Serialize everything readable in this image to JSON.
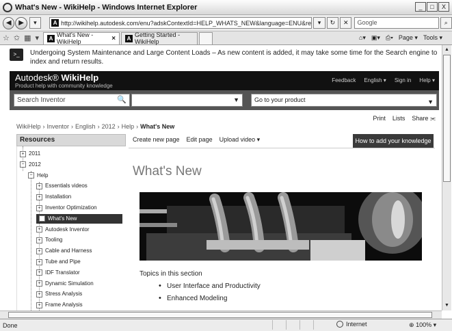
{
  "window": {
    "title": "What's New - WikiHelp - Windows Internet Explorer",
    "buttons": [
      "_",
      "□",
      "X"
    ]
  },
  "address_bar": {
    "url": "http://wikihelp.autodesk.com/enu?adskContextId=HELP_WHATS_NEW&language=ENU&release=2012&product=Inve",
    "search_placeholder": "Google"
  },
  "tabs": [
    {
      "label": "What's New - WikiHelp",
      "active": true
    },
    {
      "label": "Getting Started - WikiHelp",
      "active": false
    }
  ],
  "commandbar": {
    "page_label": "Page",
    "tools_label": "Tools"
  },
  "notice": {
    "text": "Undergoing System Maintenance and Large Content Loads – As new content is added, it may take some time for the Search engine to index and return results."
  },
  "brand": {
    "name_prefix": "Autodesk",
    "name_product": "WikiHelp",
    "tagline": "Product help with community knowledge",
    "links": [
      "Feedback",
      "English ▾",
      "Sign in",
      "Help ▾"
    ]
  },
  "search": {
    "placeholder": "Search Inventor",
    "goto_label": "Go to your product"
  },
  "page_tools": [
    "Print",
    "Lists",
    "Share"
  ],
  "breadcrumb": [
    "WikiHelp",
    "Inventor",
    "English",
    "2012",
    "Help"
  ],
  "breadcrumb_current": "What's New",
  "resources": {
    "title": "Resources",
    "tree": [
      {
        "label": "2011",
        "level": 0,
        "exp": "+"
      },
      {
        "label": "2012",
        "level": 0,
        "exp": "−"
      },
      {
        "label": "Help",
        "level": 1,
        "exp": "−"
      },
      {
        "label": "Essentials videos",
        "level": 2,
        "exp": "+"
      },
      {
        "label": "Installation",
        "level": 2,
        "exp": "+"
      },
      {
        "label": "Inventor Optimization",
        "level": 2,
        "exp": "+"
      },
      {
        "label": "What's New",
        "level": 2,
        "exp": "+",
        "selected": true
      },
      {
        "label": "Autodesk Inventor",
        "level": 2,
        "exp": "+"
      },
      {
        "label": "Tooling",
        "level": 2,
        "exp": "+"
      },
      {
        "label": "Cable and Harness",
        "level": 2,
        "exp": "+"
      },
      {
        "label": "Tube and Pipe",
        "level": 2,
        "exp": "+"
      },
      {
        "label": "IDF Translator",
        "level": 2,
        "exp": "+"
      },
      {
        "label": "Dynamic Simulation",
        "level": 2,
        "exp": "+"
      },
      {
        "label": "Stress Analysis",
        "level": 2,
        "exp": "+"
      },
      {
        "label": "Frame Analysis",
        "level": 2,
        "exp": "+"
      }
    ]
  },
  "actions": [
    "Create new page",
    "Edit page",
    "Upload video ▾"
  ],
  "howto_label": "How to add your knowledge",
  "content": {
    "title": "What's New",
    "topics_heading": "Topics in this section",
    "topics": [
      "User Interface and Productivity",
      "Enhanced Modeling"
    ]
  },
  "status": {
    "left": "Done",
    "zone": "Internet",
    "zoom": "100%"
  }
}
